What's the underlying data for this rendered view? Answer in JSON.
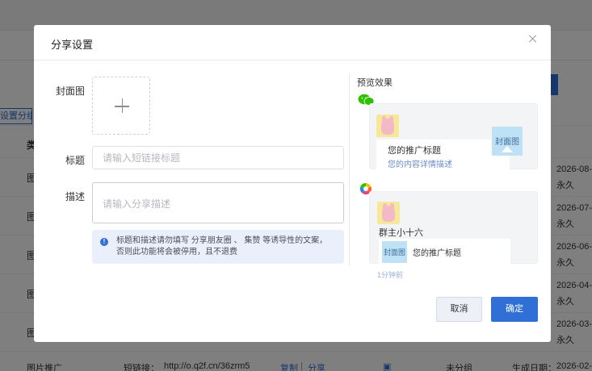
{
  "background": {
    "group_button": "设置分组",
    "header_type": "类",
    "type_cells": [
      "图",
      "图",
      "图",
      "图",
      "图"
    ],
    "dates": [
      "2026-08-",
      "2026-07-",
      "2026-06-",
      "2026-04-",
      "2026-03-"
    ],
    "permanence": [
      "永久",
      "永久",
      "永久",
      "永久",
      "永久"
    ],
    "bottom_row": {
      "type": "图片推广",
      "link_label": "短链接：",
      "link_value": "http://o.q2f.cn/36zrm5",
      "copy": "复制",
      "separator": "|",
      "share": "分享",
      "group": "未分组",
      "created_label": "生成日期：",
      "created_value": "2026-02-"
    }
  },
  "modal": {
    "title": "分享设置",
    "close_icon": "close-icon",
    "cover_label": "封面图",
    "title_label": "标题",
    "title_placeholder": "请输入短链接标题",
    "desc_label": "描述",
    "desc_placeholder": "请输入分享描述",
    "notice": "标题和描述请勿填写 分享朋友圈 、 集赞 等诱导性的文案，否则此功能将会被停用，且不退费",
    "preview": {
      "title": "预览效果",
      "wechat_card": {
        "link_title": "您的推广标题",
        "link_desc": "您的内容详情描述",
        "cover_label": "封面图"
      },
      "moments_card": {
        "user_name": "群主小十六",
        "cover_label": "封面图",
        "link_title": "您的推广标题",
        "time": "1分钟前"
      }
    },
    "cancel_label": "取消",
    "ok_label": "确定"
  },
  "colors": {
    "accent": "#2f6fd6",
    "overlay": "rgba(0,0,0,0.5)",
    "notice_bg": "#eaf0fb",
    "wechat_green": "#2dc100"
  }
}
